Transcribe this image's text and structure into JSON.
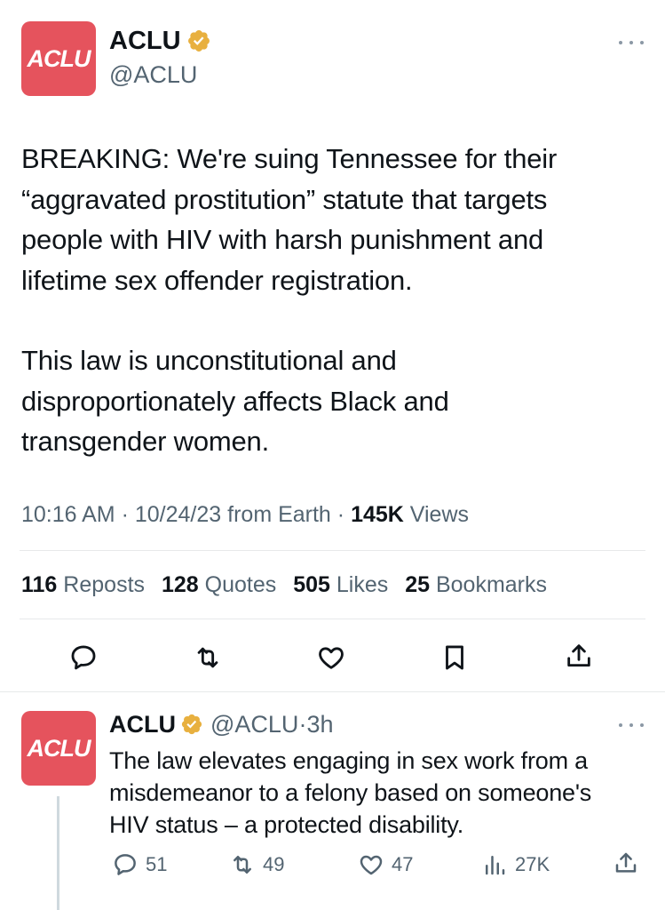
{
  "main_tweet": {
    "avatar_text": "ACLU",
    "display_name": "ACLU",
    "handle": "@ACLU",
    "paragraph1_lines": [
      "BREAKING: We're suing Tennessee for their",
      "“aggravated prostitution” statute that targets",
      "people with HIV with harsh punishment and",
      "lifetime sex offender registration."
    ],
    "paragraph2_lines": [
      "This law is unconstitutional and",
      "disproportionately affects Black and",
      "transgender women."
    ],
    "time": "10:16 AM",
    "date": "10/24/23",
    "source": "from Earth",
    "views_count": "145K",
    "views_label": "Views",
    "stats": {
      "reposts_count": "116",
      "reposts_label": "Reposts",
      "quotes_count": "128",
      "quotes_label": "Quotes",
      "likes_count": "505",
      "likes_label": "Likes",
      "bookmarks_count": "25",
      "bookmarks_label": "Bookmarks"
    }
  },
  "reply_tweet": {
    "avatar_text": "ACLU",
    "display_name": "ACLU",
    "handle": "@ACLU",
    "age": "3h",
    "text_lines": [
      "The law elevates engaging in sex work from a",
      "misdemeanor to a felony based on someone's",
      "HIV status – a protected disability."
    ],
    "replies": "51",
    "reposts": "49",
    "likes": "47",
    "views": "27K"
  },
  "colors": {
    "brand_red": "#e5535d",
    "verified_gold": "#e8b03f",
    "text": "#0f1419",
    "muted": "#536471",
    "divider": "#e7e9ea"
  },
  "icons": [
    "more-icon",
    "verified-badge-icon",
    "reply-icon",
    "repost-icon",
    "like-icon",
    "bookmark-icon",
    "share-icon",
    "views-icon"
  ]
}
